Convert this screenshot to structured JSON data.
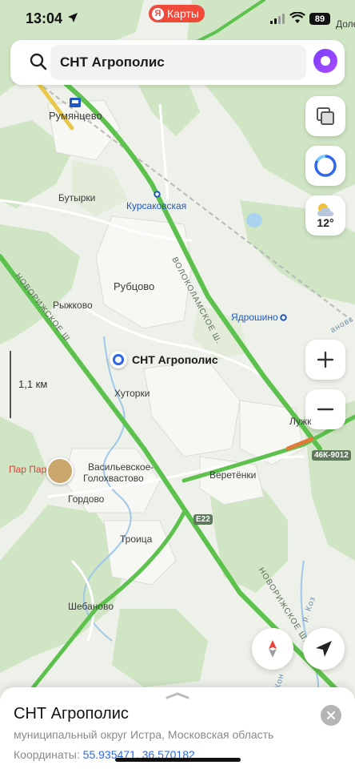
{
  "status": {
    "time": "13:04",
    "app_name": "Карты",
    "app_badge": "Я",
    "battery": "89"
  },
  "search": {
    "value": "СНТ Агрополис"
  },
  "weather": {
    "temp": "12°"
  },
  "scale": {
    "label": "1,1 км"
  },
  "map": {
    "places": {
      "rumyantsevo": "Румянцево",
      "butyrki": "Бутырки",
      "kursakovskaya": "Курсаковская",
      "rubtsovo": "Рубцово",
      "ryzhkovo": "Рыжково",
      "yadroshino": "Ядрошино",
      "khutorki": "Хуторки",
      "vasilevskoe1": "Васильевское-",
      "vasilevskoe2": "Голохвастово",
      "gordovo": "Гордово",
      "veretenki": "Веретёнки",
      "troitsa": "Троица",
      "shebanovo": "Шебаново",
      "luzhki": "Лужк",
      "dole": "Доле"
    },
    "roads": {
      "novorizhskoe_1": "НОВОРИЖСКОЕ Ш.",
      "volokolamskoe": "ВОЛОКОЛАМСКОЕ Ш.",
      "novorizhskoe_2": "НОВОРИЖСКОЕ Ш.",
      "r_koz": "р. Коз",
      "r_kon": "Кон",
      "right_edge": "ановс"
    },
    "shields": {
      "e22": "E22",
      "r46k": "46К-9012"
    },
    "pin_label": "СНТ Агрополис",
    "poi_label": "Пар Пар"
  },
  "sheet": {
    "title": "СНТ Агрополис",
    "subtitle": "муниципальный округ Истра, Московская область",
    "coords_label": "Координаты:",
    "coords_value": "55.935471, 36.570182"
  },
  "colors": {
    "accent": "#2f68e8",
    "road": "#5dc24d",
    "forest": "#cfe5c4",
    "land": "#eef1e9",
    "brand": "#f04a3a"
  }
}
